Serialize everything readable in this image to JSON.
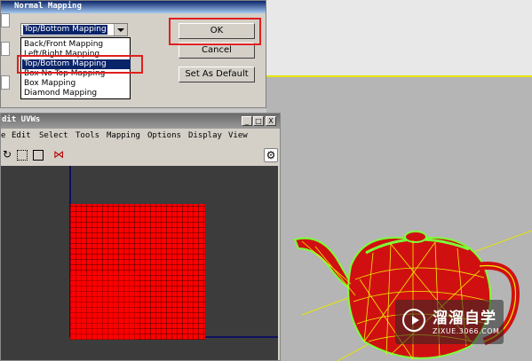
{
  "normal_mapping": {
    "title": "Normal Mapping",
    "selected_value": "Top/Bottom Mapping",
    "options": [
      "Back/Front Mapping",
      "Left/Right Mapping",
      "Top/Bottom Mapping",
      "Box No Top Mapping",
      "Box Mapping",
      "Diamond Mapping"
    ],
    "highlighted_option_index": 2,
    "buttons": {
      "ok": "OK",
      "cancel": "Cancel",
      "set_default": "Set As Default"
    }
  },
  "edit_uvws": {
    "title": "dit UVWs",
    "window_buttons": [
      "_",
      "□",
      "X"
    ],
    "menu": [
      "e",
      "Edit",
      "Select",
      "Tools",
      "Mapping",
      "Options",
      "Display",
      "View"
    ],
    "toolbar_icons": [
      "rotate-icon",
      "freeform-icon",
      "scale-icon",
      "mirror-icon",
      "options-icon"
    ]
  },
  "watermark": {
    "title": "溜溜自学",
    "subtitle": "ZIXUE.3066.COM"
  },
  "colors": {
    "uv_red": "#ff0000",
    "highlight_box": "#e01f1f",
    "selection_blue": "#0a246a",
    "viewport_bg": "#b5b5b5",
    "teapot_red": "#d01010",
    "wire_yellow": "#f0f000"
  }
}
